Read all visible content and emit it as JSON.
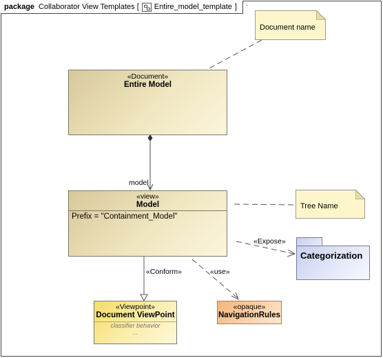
{
  "frame": {
    "keyword": "package",
    "title_prefix": "Collaborator View Templates [",
    "diagram_name": "Entire_model_template",
    "title_suffix": "]",
    "dot": "."
  },
  "notes": {
    "document_name": "Document name",
    "tree_name": "Tree Name"
  },
  "document": {
    "stereotype": "«Document»",
    "name": "Entire Model"
  },
  "view": {
    "stereotype": "«view»",
    "name": "Model",
    "attribute": "Prefix = \"Containment_Model\""
  },
  "package": {
    "name": "Categorization"
  },
  "viewpoint": {
    "stereotype": "«Viewpoint»",
    "name": "Document ViewPoint",
    "compartment": "classifier behavior",
    "ellipsis": "..."
  },
  "opaque": {
    "stereotype": "«opaque»",
    "name": "NavigationRules"
  },
  "edges": {
    "model_role": "model",
    "expose": "«Expose»",
    "conform": "«Conform»",
    "use": "«use»"
  }
}
